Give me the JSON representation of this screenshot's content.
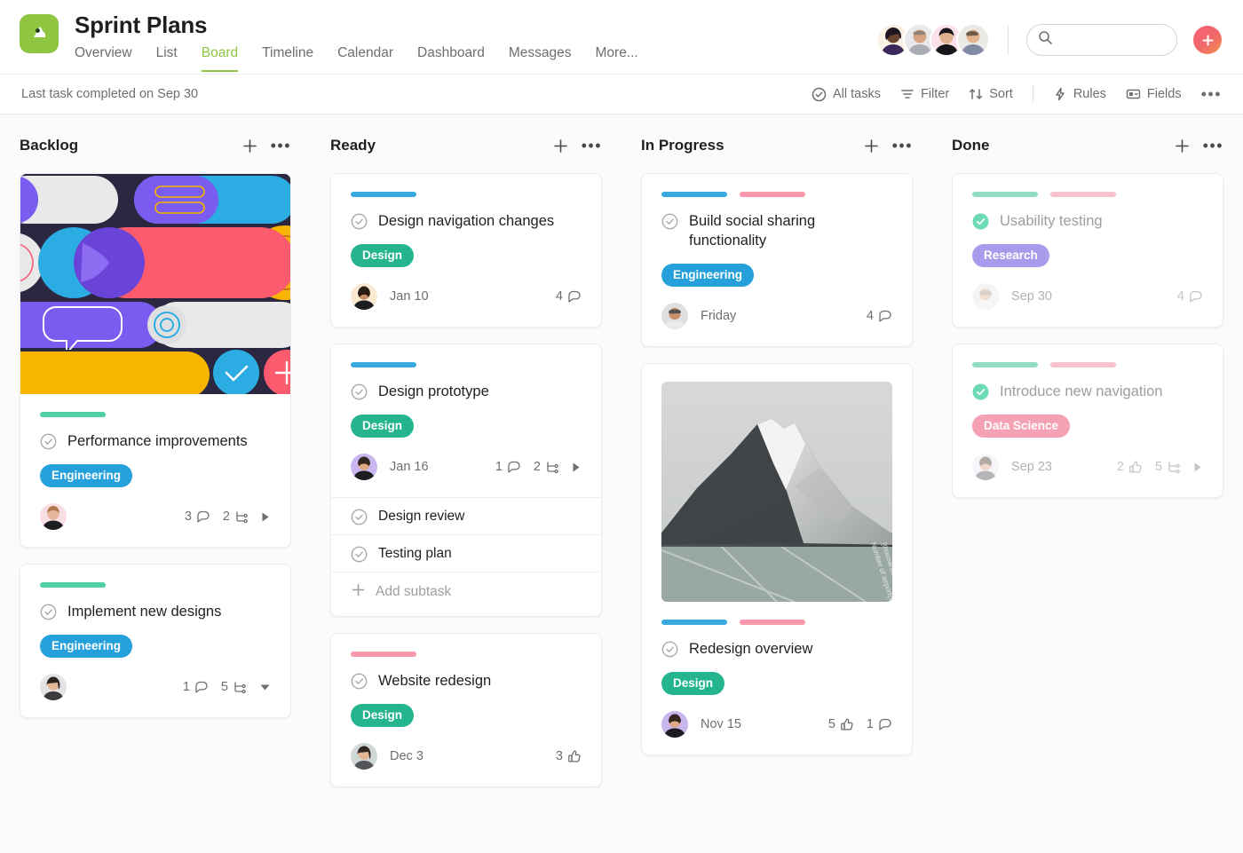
{
  "header": {
    "project_title": "Sprint Plans",
    "logo_icon": "asana-project-icon",
    "tabs": [
      {
        "label": "Overview",
        "active": false
      },
      {
        "label": "List",
        "active": false
      },
      {
        "label": "Board",
        "active": true
      },
      {
        "label": "Timeline",
        "active": false
      },
      {
        "label": "Calendar",
        "active": false
      },
      {
        "label": "Dashboard",
        "active": false
      },
      {
        "label": "Messages",
        "active": false
      },
      {
        "label": "More...",
        "active": false
      }
    ],
    "members": [
      "member-1",
      "member-2",
      "member-3",
      "member-4"
    ],
    "search": {
      "placeholder": "",
      "value": "",
      "icon": "search-icon"
    },
    "add_button": {
      "label": "+",
      "icon": "plus-icon",
      "color": "#f06a6a"
    },
    "accent_color": "#8ec641"
  },
  "toolbar": {
    "status_text": "Last task completed on Sep 30",
    "tools": [
      {
        "label": "All tasks",
        "icon": "check-circle-icon"
      },
      {
        "label": "Filter",
        "icon": "filter-icon"
      },
      {
        "label": "Sort",
        "icon": "sort-icon"
      },
      {
        "label": "Rules",
        "icon": "lightning-icon"
      },
      {
        "label": "Fields",
        "icon": "fields-icon"
      }
    ],
    "overflow_label": "•••"
  },
  "board": {
    "add_card_icon": "plus-icon",
    "column_menu_icon": "ellipsis-icon",
    "columns": [
      {
        "name": "Backlog",
        "cards": [
          {
            "title": "Performance improvements",
            "cover": "abstract-collage-cover",
            "bars": [
              "#4ecfa5"
            ],
            "tag": {
              "label": "Engineering",
              "color": "#25a0db"
            },
            "assignee": "assignee-avatar",
            "due": "",
            "metrics": [
              {
                "icon": "comment-icon",
                "count": "3"
              },
              {
                "icon": "subtask-icon",
                "count": "2"
              }
            ],
            "expander": "caret-right-icon",
            "done": false
          },
          {
            "title": "Implement new designs",
            "bars": [
              "#4ecfa5"
            ],
            "tag": {
              "label": "Engineering",
              "color": "#25a0db"
            },
            "assignee": "assignee-avatar",
            "due": "",
            "metrics": [
              {
                "icon": "comment-icon",
                "count": "1"
              },
              {
                "icon": "subtask-icon",
                "count": "5"
              }
            ],
            "expander": "caret-down-icon",
            "done": false
          }
        ]
      },
      {
        "name": "Ready",
        "cards": [
          {
            "title": "Design navigation changes",
            "bars": [
              "#3aa9e0"
            ],
            "tag": {
              "label": "Design",
              "color": "#24b58e"
            },
            "assignee": "assignee-avatar",
            "due": "Jan 10",
            "metrics": [
              {
                "icon": "comment-icon",
                "count": "4"
              }
            ],
            "done": false
          },
          {
            "title": "Design prototype",
            "bars": [
              "#3aa9e0"
            ],
            "tag": {
              "label": "Design",
              "color": "#24b58e"
            },
            "assignee": "assignee-avatar",
            "due": "Jan 16",
            "metrics": [
              {
                "icon": "comment-icon",
                "count": "1"
              },
              {
                "icon": "subtask-icon",
                "count": "2"
              }
            ],
            "expander": "caret-right-icon",
            "subtasks": [
              "Design review",
              "Testing plan"
            ],
            "add_subtask_label": "Add subtask",
            "done": false
          },
          {
            "title": "Website redesign",
            "bars": [
              "#f897ab"
            ],
            "tag": {
              "label": "Design",
              "color": "#24b58e"
            },
            "assignee": "assignee-avatar",
            "due": "Dec 3",
            "metrics": [
              {
                "icon": "like-icon",
                "count": "3"
              }
            ],
            "done": false
          }
        ]
      },
      {
        "name": "In Progress",
        "cards": [
          {
            "title": "Build social sharing functionality",
            "bars": [
              "#3aa9e0",
              "#f897ab"
            ],
            "tag": {
              "label": "Engineering",
              "color": "#25a0db"
            },
            "assignee": "assignee-avatar",
            "due": "Friday",
            "metrics": [
              {
                "icon": "comment-icon",
                "count": "4"
              }
            ],
            "done": false
          },
          {
            "title": "Redesign overview",
            "cover": "mountain-photo-cover",
            "bars": [
              "#3aa9e0",
              "#f897ab"
            ],
            "tag": {
              "label": "Design",
              "color": "#24b58e"
            },
            "assignee": "assignee-avatar",
            "due": "Nov 15",
            "metrics": [
              {
                "icon": "like-icon",
                "count": "5"
              },
              {
                "icon": "comment-icon",
                "count": "1"
              }
            ],
            "done": false
          }
        ]
      },
      {
        "name": "Done",
        "cards": [
          {
            "title": "Usability testing",
            "bars": [
              "#8fdcc0",
              "#f8c2cf"
            ],
            "tag": {
              "label": "Research",
              "color": "#a99bec"
            },
            "assignee": "assignee-avatar",
            "due": "Sep 30",
            "metrics": [
              {
                "icon": "comment-icon",
                "count": "4"
              }
            ],
            "done": true
          },
          {
            "title": "Introduce new navigation",
            "bars": [
              "#8fdcc0",
              "#f8c2cf"
            ],
            "tag": {
              "label": "Data Science",
              "color": "#f4a1b4"
            },
            "assignee": "assignee-avatar",
            "due": "Sep 23",
            "metrics": [
              {
                "icon": "like-icon",
                "count": "2"
              },
              {
                "icon": "subtask-icon",
                "count": "5"
              }
            ],
            "expander": "caret-right-icon",
            "done": true
          }
        ]
      }
    ]
  }
}
